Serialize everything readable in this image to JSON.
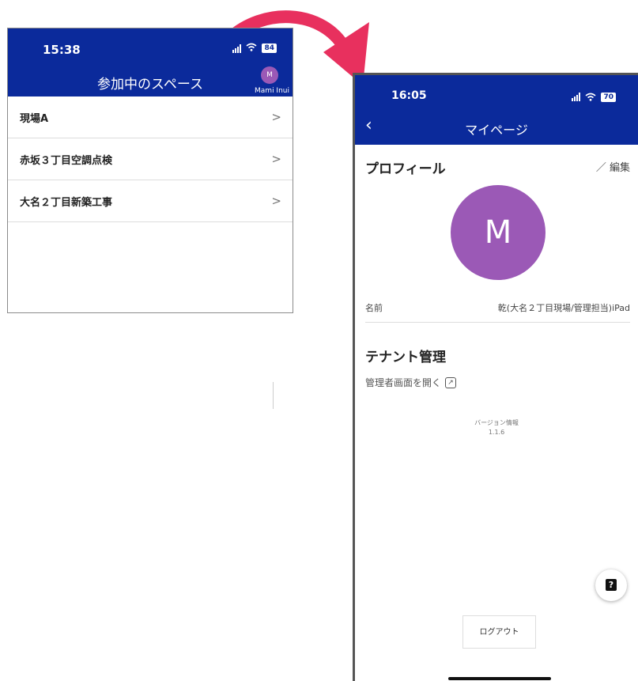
{
  "left_screen": {
    "status_time": "15:38",
    "battery": "84",
    "title": "参加中のスペース",
    "avatar_initial": "M",
    "user_name": "Mami Inui",
    "spaces": [
      {
        "label": "現場A"
      },
      {
        "label": "赤坂３丁目空調点検"
      },
      {
        "label": "大名２丁目新築工事"
      }
    ]
  },
  "right_screen": {
    "status_time": "16:05",
    "battery": "70",
    "title": "マイページ",
    "profile_heading": "プロフィール",
    "edit_label": "編集",
    "avatar_initial": "M",
    "name_label": "名前",
    "name_value": "乾(大名２丁目現場/管理担当)iPad",
    "tenant_heading": "テナント管理",
    "admin_link": "管理者画面を開く",
    "version_label": "バージョン情報",
    "version_value": "1.1.6",
    "logout_label": "ログアウト"
  },
  "icons": {
    "back": "chevron-left-icon",
    "chevron": "chevron-right-icon",
    "edit": "pencil-icon",
    "external_link": "external-link-icon",
    "help": "help-icon",
    "transition_arrow": "curved-arrow-icon"
  },
  "colors": {
    "header_blue": "#0b2a9b",
    "avatar_purple": "#9b59b6",
    "arrow_pink": "#e8305e"
  }
}
